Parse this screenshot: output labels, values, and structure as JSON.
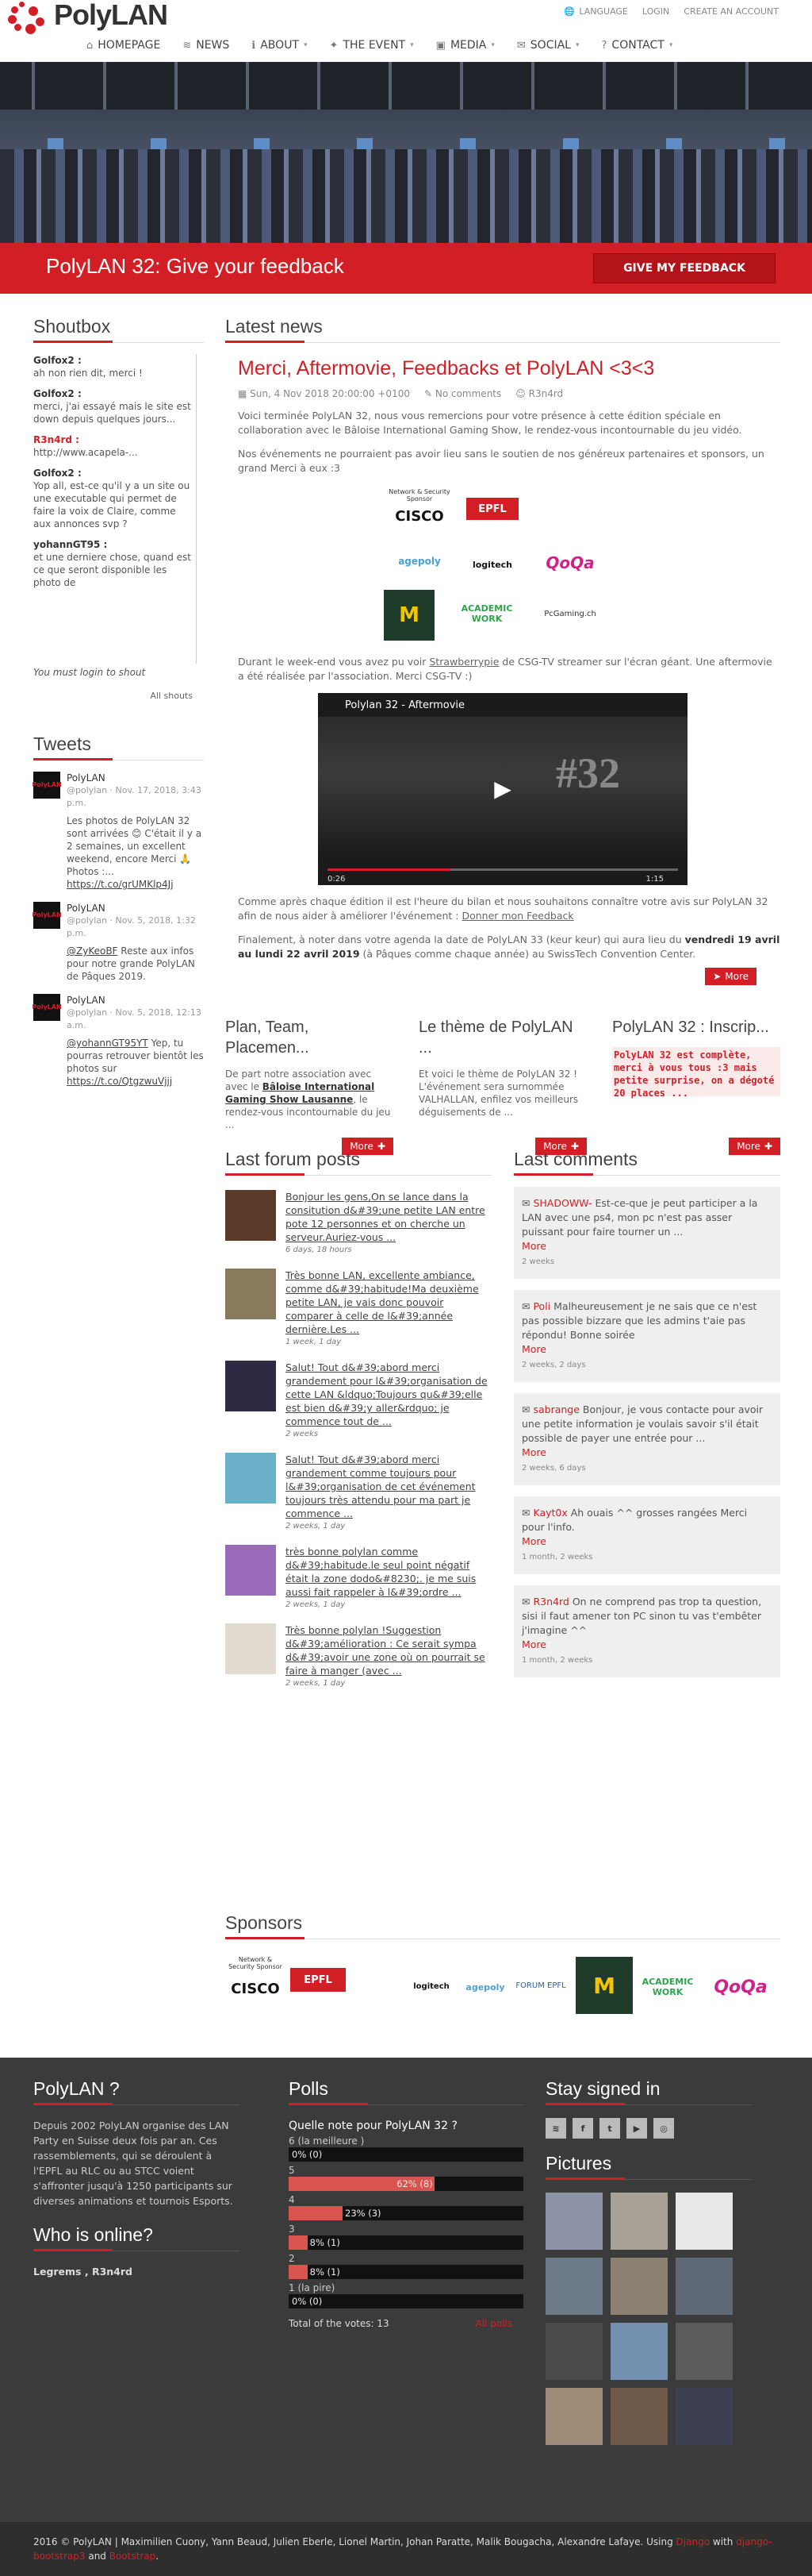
{
  "brand": {
    "name": "PolyLAN"
  },
  "top_links": [
    "LANGUAGE",
    "LOGIN",
    "CREATE AN ACCOUNT"
  ],
  "nav": [
    {
      "label": "HOMEPAGE",
      "icon": "home-icon"
    },
    {
      "label": "NEWS",
      "icon": "rss-icon"
    },
    {
      "label": "ABOUT",
      "icon": "info-icon"
    },
    {
      "label": "THE EVENT",
      "icon": "gamepad-icon"
    },
    {
      "label": "MEDIA",
      "icon": "image-icon"
    },
    {
      "label": "SOCIAL",
      "icon": "comments-icon"
    },
    {
      "label": "CONTACT",
      "icon": "question-icon"
    }
  ],
  "banner": {
    "title": "PolyLAN 32: Give your feedback",
    "button": "GIVE MY FEEDBACK"
  },
  "shoutbox": {
    "title": "Shoutbox",
    "entries": [
      {
        "user": "Golfox2 :",
        "text": "ah non rien dit, merci !"
      },
      {
        "user": "Golfox2 :",
        "text": "merci, j'ai essayé mais le site est down depuis quelques jours..."
      },
      {
        "user": "R3n4rd :",
        "text": "http://www.acapela-..."
      },
      {
        "user": "Golfox2 :",
        "text": "Yop all, est-ce qu'il y a un site ou une executable qui permet de faire la voix de Claire, comme aux annonces svp ?"
      },
      {
        "user": "yohannGT95 :",
        "text": "et une derniere chose, quand est ce que seront disponible les photo de"
      }
    ],
    "login_note": "You must login to shout",
    "all_shouts": "All shouts"
  },
  "tweets": {
    "title": "Tweets",
    "items": [
      {
        "name": "PolyLAN",
        "handle": "@polylan",
        "date": "· Nov. 17, 2018, 3:43 p.m.",
        "text": "Les photos de PolyLAN 32 sont arrivées 😊 C'était il y a 2 semaines, un excellent weekend, encore Merci 🙏 Photos :...",
        "link": "https://t.co/grUMKlp4Jj"
      },
      {
        "name": "PolyLAN",
        "handle": "@polylan",
        "date": "· Nov. 5, 2018, 1:32 p.m.",
        "link_prefix": "@ZyKeoBF",
        "text": "Reste aux infos pour notre grande PolyLAN de Pâques 2019."
      },
      {
        "name": "PolyLAN",
        "handle": "@polylan",
        "date": "· Nov. 5, 2018, 12:13 a.m.",
        "link_prefix": "@yohannGT95YT",
        "text": "Yep, tu pourras retrouver bientôt les photos sur",
        "link": "https://t.co/QtgzwuVjjj"
      }
    ]
  },
  "news": {
    "title": "Latest news",
    "article": {
      "title": "Merci, Aftermovie, Feedbacks et PolyLAN <3<3",
      "date": "Sun, 4 Nov 2018 20:00:00 +0100",
      "comments": "No comments",
      "author": "R3n4rd",
      "p1": "Voici terminée PolyLAN 32, nous vous remercions pour votre présence à cette édition spéciale en collaboration avec le Bâloise International Gaming Show, le rendez-vous incontournable du jeu vidéo.",
      "p2": "Nos événements ne pourraient pas avoir lieu sans le soutien de nos généreux partenaires et sponsors, un grand Merci à eux :3",
      "p3_a": "Durant le week-end vous avez pu voir ",
      "p3_link": "Strawberrypie",
      "p3_b": " de CSG-TV streamer sur l'écran géant. Une aftermovie a été réalisée par l'association. Merci CSG-TV :)",
      "video_title": "Polylan 32 - Aftermovie",
      "video_time_left": "0:26",
      "video_time_right": "1:15",
      "p4_a": "Comme après chaque édition il est l'heure du bilan et nous souhaitons connaître votre avis sur PolyLAN 32 afin de nous aider à améliorer l'événement : ",
      "p4_link": "Donner mon Feedback",
      "p5_a": "Finalement, à noter dans votre agenda la date de PolyLAN 33 (keur keur) qui aura lieu du ",
      "p5_bold": "vendredi 19 avril au lundi 22 avril 2019",
      "p5_b": " (à Pâques comme chaque année) au SwissTech Convention Center.",
      "more": "More"
    },
    "sponsor_labels": [
      "Network & Security Sponsor",
      "CISCO",
      "EPFL",
      "agepoly",
      "logitech",
      "QoQa",
      "ACADEMIC WORK",
      "PcGaming.ch"
    ],
    "cards": [
      {
        "title": "Plan, Team, Placemen...",
        "body_a": "De part notre association avec avec le ",
        "body_bold": "Bâloise International Gaming Show Lausanne",
        "body_b": ", le rendez-vous incontournable du jeu ...",
        "more": "More"
      },
      {
        "title": "Le thème de PolyLAN ...",
        "body": "Et voici le thème de PolyLAN 32 ! L'événement sera surnommée VALHALLAN, enfilez vos meilleurs déguisements de ...",
        "more": "More"
      },
      {
        "title": "PolyLAN 32 : Inscrip...",
        "body": "PolyLAN 32 est complète, merci à vous tous :3 mais petite surprise, on a dégoté 20 places ...",
        "more": "More"
      }
    ]
  },
  "forum": {
    "title": "Last forum posts",
    "posts": [
      {
        "text": "Bonjour les gens,On se lance dans la consitution d&#39;une petite LAN entre pote 12 personnes et on cherche un serveur.Auriez-vous ...",
        "date": "6 days, 18 hours"
      },
      {
        "text": "Très bonne LAN, excellente ambiance, comme d&#39;habitude!Ma deuxième petite LAN, je vais donc pouvoir comparer à celle de l&#39;année dernière.Les ...",
        "date": "1 week, 1 day"
      },
      {
        "text": "Salut! Tout d&#39;abord merci grandement pour l&#39;organisation de cette LAN &ldquo;Toujours qu&#39;elle est bien d&#39;y aller&rdquo; je commence tout de ...",
        "date": "2 weeks"
      },
      {
        "text": "Salut! Tout d&#39;abord merci grandement comme toujours pour l&#39;organisation de cet événement toujours très attendu pour ma part je commence ...",
        "date": "2 weeks, 1 day"
      },
      {
        "text": "très bonne polylan comme d&#39;habitude.le seul point négatif était la zone dodo&#8230;. je me suis aussi fait rappeler à l&#39;ordre ...",
        "date": "2 weeks, 1 day"
      },
      {
        "text": "Très bonne polylan !Suggestion d&#39;amélioration : Ce serait sympa d&#39;avoir une zone où on pourrait se faire à manger (avec ...",
        "date": "2 weeks, 1 day"
      }
    ]
  },
  "comments": {
    "title": "Last comments",
    "items": [
      {
        "user": "SHADOWW-",
        "text": " Est-ce-que je peut participer a la LAN avec une ps4, mon pc n'est pas asser puissant pour faire tourner un ...",
        "more": "More",
        "date": "2 weeks"
      },
      {
        "user": "Poli",
        "text": " Malheureusement je ne sais que ce n'est pas possible bizzare que les admins t'aie pas répondu! Bonne soirée",
        "more": "More",
        "date": "2 weeks, 2 days"
      },
      {
        "user": "sabrange",
        "text": " Bonjour, je vous contacte pour avoir une petite information je voulais savoir s'il était possible de payer une entrée pour ...",
        "more": "More",
        "date": "2 weeks, 6 days"
      },
      {
        "user": "Kayt0x",
        "text": " Ah ouais ^^ grosses rangées Merci pour l'info.",
        "more": "More",
        "date": "1 month, 2 weeks"
      },
      {
        "user": "R3n4rd",
        "text": " On ne comprend pas trop ta question, sisi il faut amener ton PC sinon tu vas t'embêter j'imagine ^^",
        "more": "More",
        "date": "1 month, 2 weeks"
      }
    ]
  },
  "sponsors": {
    "title": "Sponsors"
  },
  "footer": {
    "about_title": "PolyLAN ?",
    "about_text": "Depuis 2002 PolyLAN organise des LAN Party en Suisse deux fois par an. Ces rassemblements, qui se déroulent à l'EPFL au RLC ou au STCC voient s'affronter jusqu'à 1250 participants sur diverses animations et tournois Esports.",
    "online_title": "Who is online?",
    "online_users": "Legrems , R3n4rd",
    "polls_title": "Polls",
    "poll_question": "Quelle note pour PolyLAN 32 ?",
    "poll_rows": [
      {
        "label": "6 (la meilleure )",
        "text": "0% (0)",
        "pct": 0
      },
      {
        "label": "5",
        "text": "62% (8)",
        "pct": 62
      },
      {
        "label": "4",
        "text": "23% (3)",
        "pct": 23
      },
      {
        "label": "3",
        "text": "8% (1)",
        "pct": 8
      },
      {
        "label": "2",
        "text": "8% (1)",
        "pct": 8
      },
      {
        "label": "1 (la pire)",
        "text": "0% (0)",
        "pct": 0
      }
    ],
    "poll_total": "Total of the votes: 13",
    "poll_all": "All polls",
    "stay_title": "Stay signed in",
    "pictures_title": "Pictures"
  },
  "copyright": {
    "text": "2016 © PolyLAN | Maximilien Cuony, Yann Beaud, Julien Eberle, Lionel Martin, Johan Paratte, Malik Bougacha, Alexandre Lafaye. Using",
    "l1": "Django",
    "mid": "with",
    "l2": "django-bootstrap3",
    "and": "and",
    "l3": "Bootstrap",
    "end": "."
  },
  "colors": {
    "accent": "#d21f26",
    "footer_bg": "#3b3b3b"
  }
}
